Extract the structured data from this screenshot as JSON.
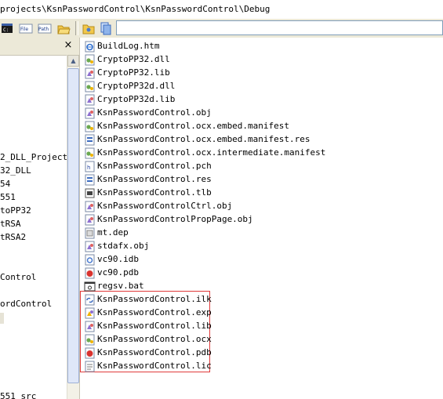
{
  "titlebar": {
    "path": "projects\\KsnPasswordControl\\KsnPasswordControl\\Debug"
  },
  "toolbar": {
    "buttons": [
      {
        "name": "console-icon",
        "label": ""
      },
      {
        "name": "file-icon",
        "label": "File"
      },
      {
        "name": "path-icon",
        "label": "Path"
      },
      {
        "name": "open-folder-icon",
        "label": ""
      },
      {
        "name": "folder-icon",
        "label": ""
      },
      {
        "name": "copy-icon",
        "label": ""
      }
    ],
    "address_value": ""
  },
  "left_tree": {
    "close_label": "×",
    "items": [
      "2_DLL_Project",
      "32_DLL",
      "54",
      "551",
      "toPP32",
      "tRSA",
      "tRSA2",
      "Control",
      "ordControl",
      "551 src"
    ]
  },
  "files": [
    {
      "name": "BuildLog.htm",
      "icon": "ie-htm-icon"
    },
    {
      "name": "CryptoPP32.dll",
      "icon": "dll-icon"
    },
    {
      "name": "CryptoPP32.lib",
      "icon": "lib-icon"
    },
    {
      "name": "CryptoPP32d.dll",
      "icon": "dll-icon"
    },
    {
      "name": "CryptoPP32d.lib",
      "icon": "lib-icon"
    },
    {
      "name": "KsnPasswordControl.obj",
      "icon": "obj-icon"
    },
    {
      "name": "KsnPasswordControl.ocx.embed.manifest",
      "icon": "manifest-icon"
    },
    {
      "name": "KsnPasswordControl.ocx.embed.manifest.res",
      "icon": "res-icon"
    },
    {
      "name": "KsnPasswordControl.ocx.intermediate.manifest",
      "icon": "manifest-icon"
    },
    {
      "name": "KsnPasswordControl.pch",
      "icon": "pch-icon"
    },
    {
      "name": "KsnPasswordControl.res",
      "icon": "res-icon"
    },
    {
      "name": "KsnPasswordControl.tlb",
      "icon": "tlb-icon"
    },
    {
      "name": "KsnPasswordControlCtrl.obj",
      "icon": "obj-icon"
    },
    {
      "name": "KsnPasswordControlPropPage.obj",
      "icon": "obj-icon"
    },
    {
      "name": "mt.dep",
      "icon": "dep-icon"
    },
    {
      "name": "stdafx.obj",
      "icon": "obj-icon"
    },
    {
      "name": "vc90.idb",
      "icon": "idb-icon"
    },
    {
      "name": "vc90.pdb",
      "icon": "pdb-icon"
    },
    {
      "name": "regsv.bat",
      "icon": "bat-icon"
    },
    {
      "name": "KsnPasswordControl.ilk",
      "icon": "ilk-icon"
    },
    {
      "name": "KsnPasswordControl.exp",
      "icon": "exp-icon"
    },
    {
      "name": "KsnPasswordControl.lib",
      "icon": "lib-icon"
    },
    {
      "name": "KsnPasswordControl.ocx",
      "icon": "dll-icon"
    },
    {
      "name": "KsnPasswordControl.pdb",
      "icon": "pdb-icon"
    },
    {
      "name": "KsnPasswordControl.lic",
      "icon": "text-icon"
    }
  ],
  "colors": {
    "highlight_border": "#e03a3a",
    "toolbar_bg": "#ece9d8",
    "scroll_thumb": "#dfe7f8"
  }
}
